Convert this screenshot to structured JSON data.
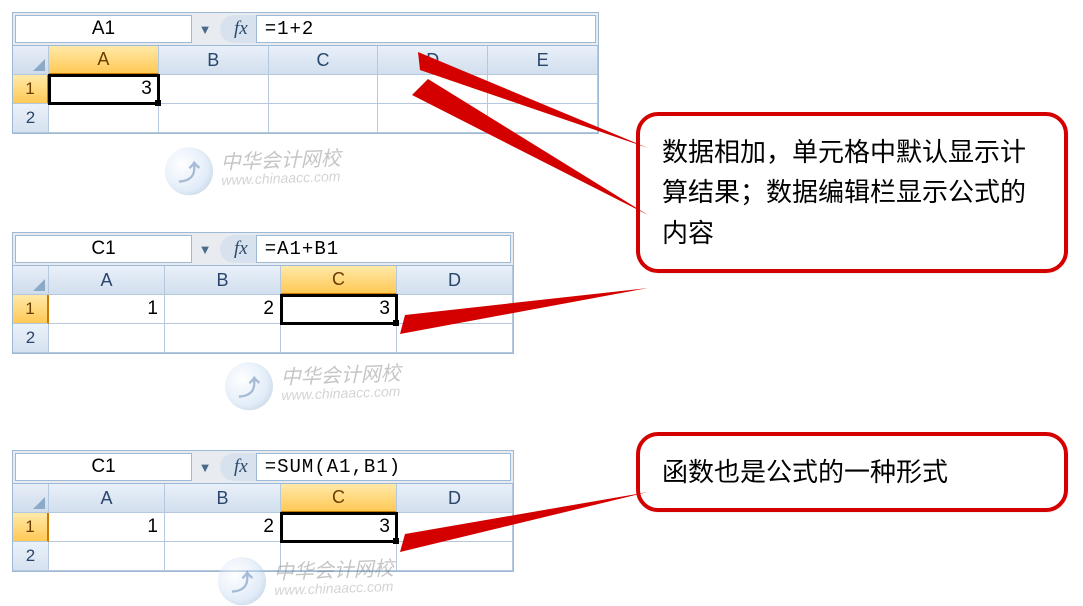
{
  "watermarks": {
    "cn": "中华会计网校",
    "url": "www.chinaacc.com"
  },
  "callouts": {
    "top": "数据相加，单元格中默认显示计算结果；数据编辑栏显示公式的内容",
    "bottom": "函数也是公式的一种形式"
  },
  "blocks": [
    {
      "nameBox": "A1",
      "formula": "=1+2",
      "columns": [
        "A",
        "B",
        "C",
        "D",
        "E"
      ],
      "selectedCol": 0,
      "rows": [
        {
          "num": "1",
          "selected": true,
          "cells": [
            "3",
            "",
            "",
            "",
            ""
          ],
          "selCell": 0
        },
        {
          "num": "2",
          "selected": false,
          "cells": [
            "",
            "",
            "",
            "",
            ""
          ],
          "selCell": -1
        }
      ]
    },
    {
      "nameBox": "C1",
      "formula": "=A1+B1",
      "columns": [
        "A",
        "B",
        "C",
        "D"
      ],
      "selectedCol": 2,
      "rows": [
        {
          "num": "1",
          "selected": true,
          "cells": [
            "1",
            "2",
            "3",
            ""
          ],
          "selCell": 2
        },
        {
          "num": "2",
          "selected": false,
          "cells": [
            "",
            "",
            "",
            ""
          ],
          "selCell": -1
        }
      ]
    },
    {
      "nameBox": "C1",
      "formula": "=SUM(A1,B1)",
      "columns": [
        "A",
        "B",
        "C",
        "D"
      ],
      "selectedCol": 2,
      "rows": [
        {
          "num": "1",
          "selected": true,
          "cells": [
            "1",
            "2",
            "3",
            ""
          ],
          "selCell": 2
        },
        {
          "num": "2",
          "selected": false,
          "cells": [
            "",
            "",
            "",
            ""
          ],
          "selCell": -1
        }
      ]
    }
  ],
  "fxLabel": "fx"
}
